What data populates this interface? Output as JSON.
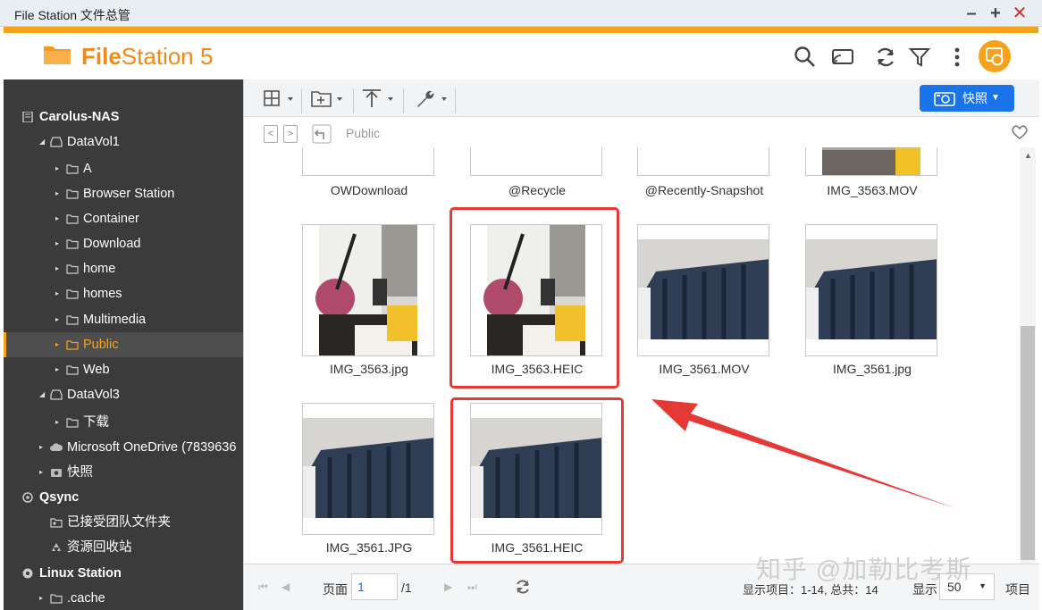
{
  "window": {
    "title": "File Station 文件总管"
  },
  "app": {
    "brand_bold": "File",
    "brand_rest": "Station 5"
  },
  "toolbar": {
    "snapshot_label": "快照"
  },
  "path": {
    "current": "Public"
  },
  "sidebar": {
    "items": [
      {
        "label": "Carolus-NAS"
      },
      {
        "label": "DataVol1"
      },
      {
        "label": "A"
      },
      {
        "label": "Browser Station"
      },
      {
        "label": "Container"
      },
      {
        "label": "Download"
      },
      {
        "label": "home"
      },
      {
        "label": "homes"
      },
      {
        "label": "Multimedia"
      },
      {
        "label": "Public"
      },
      {
        "label": "Web"
      },
      {
        "label": "DataVol3"
      },
      {
        "label": "下载"
      },
      {
        "label": "Microsoft OneDrive (7839636"
      },
      {
        "label": "快照"
      },
      {
        "label": "Qsync"
      },
      {
        "label": "已接受团队文件夹"
      },
      {
        "label": "资源回收站"
      },
      {
        "label": "Linux Station"
      },
      {
        "label": ".cache"
      }
    ]
  },
  "files": [
    {
      "name": "OWDownload"
    },
    {
      "name": "@Recycle"
    },
    {
      "name": "@Recently-Snapshot"
    },
    {
      "name": "IMG_3563.MOV"
    },
    {
      "name": "IMG_3563.jpg"
    },
    {
      "name": "IMG_3563.HEIC"
    },
    {
      "name": "IMG_3561.MOV"
    },
    {
      "name": "IMG_3561.jpg"
    },
    {
      "name": "IMG_3561.JPG"
    },
    {
      "name": "IMG_3561.HEIC"
    }
  ],
  "status": {
    "page_label": "页面",
    "page_value": "1",
    "page_total": "/1",
    "items_info": "显示项目：1-14, 总共：14",
    "show_label": "显示",
    "per_page": "50",
    "items_suffix": "项目"
  },
  "watermark": "知乎 @加勒比考斯",
  "colors": {
    "accent": "#f7a21b",
    "primary": "#1a73e8",
    "sidebar": "#3b3b3b",
    "highlight": "#e53935"
  }
}
